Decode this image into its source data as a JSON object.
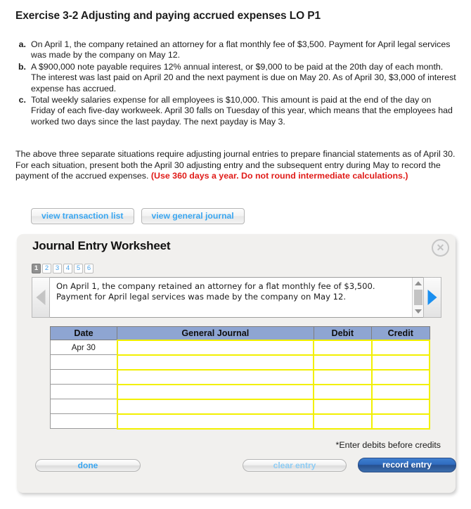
{
  "exercise": {
    "title": "Exercise 3-2 Adjusting and paying accrued expenses LO P1",
    "situations": [
      {
        "marker": "a.",
        "text": "On April 1, the company retained an attorney for a flat monthly fee of $3,500. Payment for April legal services was made by the company on May 12."
      },
      {
        "marker": "b.",
        "text": "A $900,000 note payable requires 12% annual interest, or $9,000 to be paid at the 20th day of each month. The interest was last paid on April 20 and the next payment is due on May 20. As of April 30, $3,000 of interest expense has accrued."
      },
      {
        "marker": "c.",
        "text": "Total weekly salaries expense for all employees is $10,000. This amount is paid at the end of the day on Friday of each five-day workweek. April 30 falls on Tuesday of this year, which means that the employees had worked two days since the last payday. The next payday is May 3."
      }
    ],
    "instructions_main": "The above three separate situations require adjusting journal entries to prepare financial statements as of April 30. For each situation, present both the April 30 adjusting entry and the subsequent entry during May to record the payment of the accrued expenses. ",
    "instructions_emphasis": "(Use 360 days a year. Do not round intermediate calculations.)"
  },
  "view_buttons": [
    {
      "label": "view transaction list"
    },
    {
      "label": "view general journal"
    }
  ],
  "worksheet": {
    "title": "Journal Entry Worksheet",
    "close_icon": "close-x-icon",
    "steps": [
      {
        "label": "1",
        "active": true
      },
      {
        "label": "2",
        "active": false
      },
      {
        "label": "3",
        "active": false
      },
      {
        "label": "4",
        "active": false
      },
      {
        "label": "5",
        "active": false
      },
      {
        "label": "6",
        "active": false
      }
    ],
    "prev_icon": "left-triangle-icon",
    "next_icon": "right-triangle-icon",
    "description": "On April 1, the company retained an attorney for a flat monthly fee of $3,500. Payment for April legal services was made by the company on May 12.",
    "scrollbar": {
      "up_icon": "scroll-up-triangle-icon",
      "down_icon": "scroll-down-triangle-icon"
    },
    "table": {
      "headers": [
        "Date",
        "General Journal",
        "Debit",
        "Credit"
      ],
      "rows": [
        {
          "date": "Apr 30",
          "general_journal": "",
          "debit": "",
          "credit": ""
        },
        {
          "date": "",
          "general_journal": "",
          "debit": "",
          "credit": ""
        },
        {
          "date": "",
          "general_journal": "",
          "debit": "",
          "credit": ""
        },
        {
          "date": "",
          "general_journal": "",
          "debit": "",
          "credit": ""
        },
        {
          "date": "",
          "general_journal": "",
          "debit": "",
          "credit": ""
        },
        {
          "date": "",
          "general_journal": "",
          "debit": "",
          "credit": ""
        }
      ]
    },
    "note": "*Enter debits before credits",
    "footer": {
      "done_label": "done",
      "clear_entry_label": "clear entry",
      "record_entry_label": "record entry"
    }
  },
  "colors": {
    "link_blue": "#3aa6f0",
    "emphasis_red": "#e01b18",
    "table_header_blue": "#8ea5d2",
    "entry_cell_yellow": "#f2f000",
    "record_entry_blue": "#2f6cbf",
    "panel_background": "#f1f0ee"
  }
}
